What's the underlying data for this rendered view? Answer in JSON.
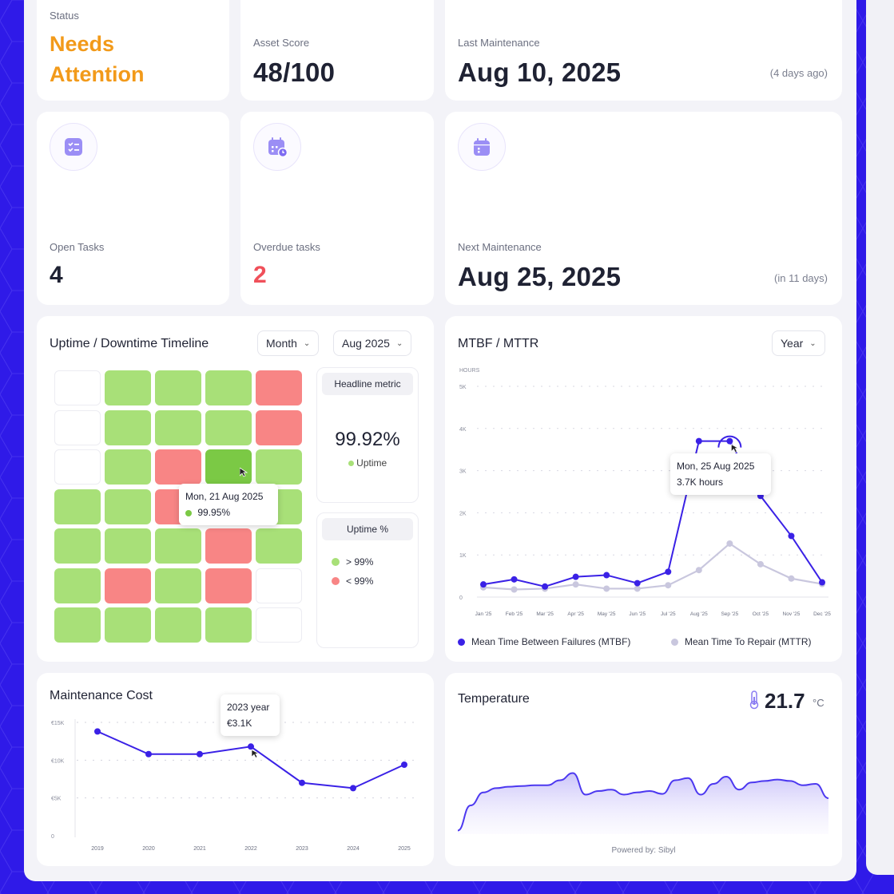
{
  "status": {
    "label": "Status",
    "value_line1": "Needs",
    "value_line2": "Attention",
    "color": "#f29a1a"
  },
  "asset_score": {
    "label": "Asset Score",
    "value": "48/100"
  },
  "last_maintenance": {
    "label": "Last Maintenance",
    "date": "Aug 10, 2025",
    "relative": "(4 days ago)"
  },
  "open_tasks": {
    "label": "Open Tasks",
    "value": "4",
    "icon": "task-list-icon"
  },
  "overdue_tasks": {
    "label": "Overdue tasks",
    "value": "2",
    "color": "#f0505a",
    "icon": "calendar-clock-icon"
  },
  "next_maintenance": {
    "label": "Next Maintenance",
    "date": "Aug 25, 2025",
    "relative": "(in 11 days)",
    "icon": "calendar-icon"
  },
  "uptime": {
    "title": "Uptime / Downtime Timeline",
    "period_select": "Month",
    "month_select": "Aug 2025",
    "grid": [
      [
        "empty",
        "green",
        "green",
        "green",
        "red"
      ],
      [
        "empty",
        "green",
        "green",
        "green",
        "red"
      ],
      [
        "empty",
        "green",
        "red",
        "selected",
        "green"
      ],
      [
        "green",
        "green",
        "red",
        "green",
        "green"
      ],
      [
        "green",
        "green",
        "green",
        "red",
        "green"
      ],
      [
        "green",
        "red",
        "green",
        "red",
        "empty"
      ],
      [
        "green",
        "green",
        "green",
        "green",
        "empty"
      ]
    ],
    "tooltip": {
      "date": "Mon, 21 Aug 2025",
      "value": "99.95%"
    },
    "headline_label": "Headline metric",
    "headline_value": "99.92%",
    "headline_caption": "Uptime",
    "legend_title": "Uptime %",
    "legend": [
      {
        "label": "> 99%",
        "color": "#a8e078"
      },
      {
        "label": "< 99%",
        "color": "#f88585"
      }
    ]
  },
  "mtbf": {
    "title": "MTBF / MTTR",
    "period_select": "Year",
    "tooltip": {
      "date": "Mon, 25 Aug 2025",
      "value": "3.7K hours"
    },
    "legend": [
      {
        "label": "Mean Time Between Failures (MTBF)",
        "color": "#3a21e6"
      },
      {
        "label": "Mean Time To Repair (MTTR)",
        "color": "#c9c7de"
      }
    ]
  },
  "maintenance_cost": {
    "title": "Maintenance Cost",
    "tooltip": {
      "label": "2023 year",
      "value": "€3.1K"
    }
  },
  "temperature": {
    "title": "Temperature",
    "value": "21.7",
    "unit": "°C",
    "footer": "Powered by: Sibyl",
    "icon": "thermometer-icon"
  },
  "chart_data": [
    {
      "type": "line",
      "title": "MTBF / MTTR",
      "ylabel": "HOURS",
      "categories": [
        "Jan '25",
        "Feb '25",
        "Mar '25",
        "Apr '25",
        "May '25",
        "Jun '25",
        "Jul '25",
        "Aug '25",
        "Sep '25",
        "Oct '25",
        "Nov '25",
        "Dec '25"
      ],
      "y_ticks": [
        "0",
        "1K",
        "2K",
        "3K",
        "4K",
        "5K"
      ],
      "ylim": [
        0,
        5000
      ],
      "series": [
        {
          "name": "Mean Time Between Failures (MTBF)",
          "color": "#3a21e6",
          "values": [
            300,
            420,
            250,
            480,
            520,
            330,
            600,
            3700,
            3700,
            2400,
            1450,
            350
          ]
        },
        {
          "name": "Mean Time To Repair (MTTR)",
          "color": "#c9c7de",
          "values": [
            230,
            180,
            200,
            300,
            200,
            200,
            280,
            640,
            1270,
            780,
            440,
            310
          ]
        }
      ],
      "legend": "bottom"
    },
    {
      "type": "line",
      "title": "Maintenance Cost",
      "categories": [
        "2019",
        "2020",
        "2021",
        "2022",
        "2023",
        "2024",
        "2025"
      ],
      "y_ticks": [
        "0",
        "€5K",
        "€10K",
        "€15K"
      ],
      "ylim": [
        0,
        15000
      ],
      "series": [
        {
          "color": "#3a21e6",
          "values": [
            13800,
            10800,
            10800,
            11800,
            7000,
            6300,
            9400
          ]
        }
      ]
    },
    {
      "type": "area",
      "title": "Temperature",
      "values": [
        5,
        40,
        58,
        64,
        66,
        67,
        68,
        68,
        75,
        85,
        55,
        60,
        62,
        55,
        58,
        60,
        56,
        75,
        78,
        55,
        70,
        80,
        62,
        72,
        74,
        76,
        74,
        68,
        70,
        50
      ],
      "color": "#4c38f0"
    }
  ]
}
